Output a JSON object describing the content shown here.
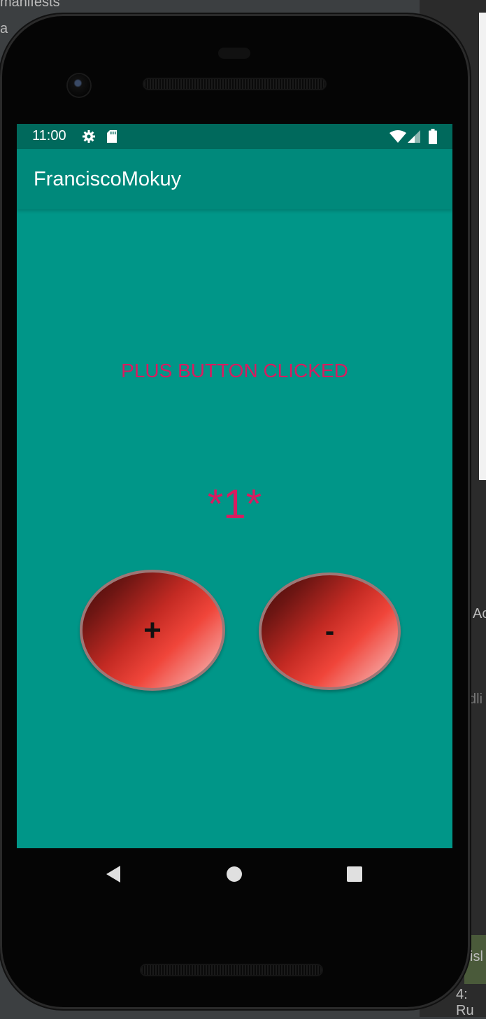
{
  "ide": {
    "top_text": "manifests",
    "side_text_1": "a",
    "side_text_2": "Ac",
    "side_text_3": "dli",
    "side_text_4": "isl",
    "side_text_5": "4: Ru"
  },
  "status_bar": {
    "time": "11:00",
    "icons": [
      "gear-icon",
      "sd-card-icon",
      "wifi-icon",
      "signal-icon",
      "battery-icon"
    ]
  },
  "app_bar": {
    "title": "FranciscoMokuy"
  },
  "main": {
    "message": "PLUS BUTTON CLICKED",
    "counter": "*1*",
    "plus_label": "+",
    "minus_label": "-"
  },
  "nav": {
    "icons": [
      "back-icon",
      "home-icon",
      "recents-icon"
    ]
  },
  "colors": {
    "screen_bg": "#009688",
    "app_bar": "#00897b",
    "status_bar": "#00695c",
    "text_accent": "#d81b60",
    "button_red": "#f0453a"
  }
}
